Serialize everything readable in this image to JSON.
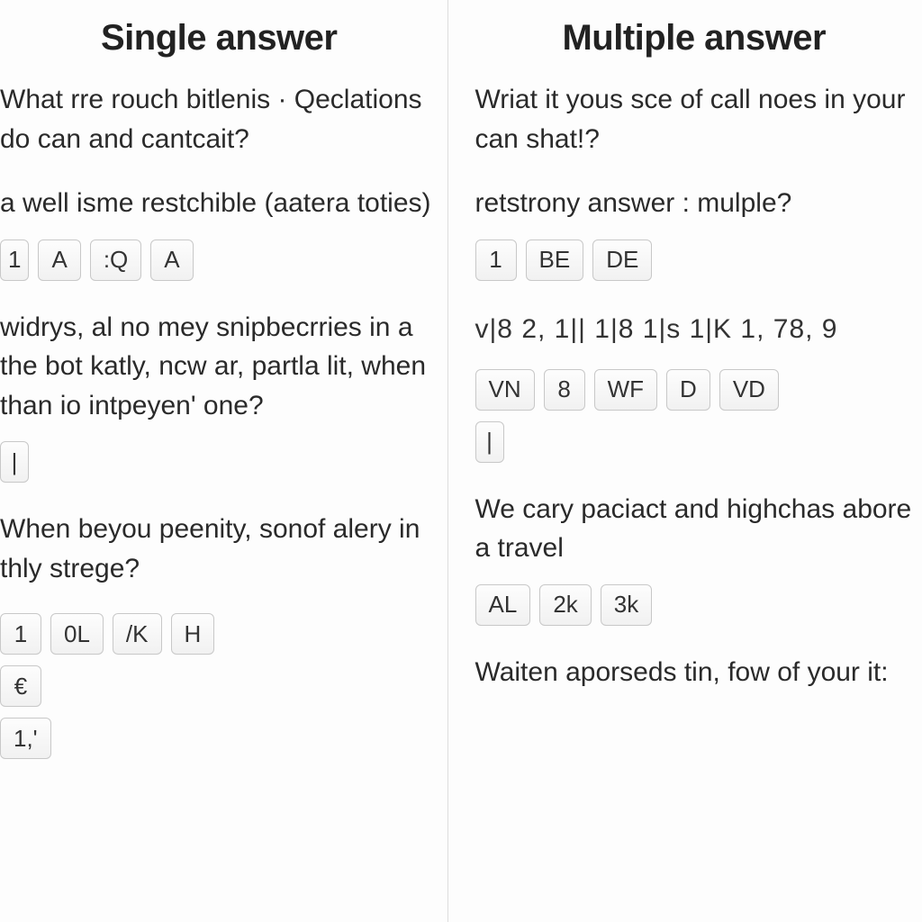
{
  "left": {
    "title": "Single answer",
    "q1": "What rre rouch bitlenis · Qeclations do can and cantcait?",
    "q2": "a well isme restchible (aatera toties)",
    "opts2": [
      "1",
      "A",
      ":Q",
      "A"
    ],
    "q3": "widrys, al no mey snipbecrries in a the bot katly, ncw ar, partla lit, when than io intpeyen' one?",
    "opts3": [
      "|"
    ],
    "q4": "When beyou peenity, sonof alery in thly strege?",
    "opts4a": [
      "1",
      "0L",
      "/K",
      "H"
    ],
    "opts4b": [
      "€"
    ],
    "opts4c": [
      "1,'"
    ]
  },
  "right": {
    "title": "Multiple answer",
    "q1": "Wriat it yous sce of call noes in your can shat!?",
    "q2": "retstrony answer : mulple?",
    "opts2": [
      "1",
      "BE",
      "DE"
    ],
    "codes": "v|8  2,  1||   1|8   1|s   1|K  1,  78,  9",
    "opts3": [
      "VN",
      "8",
      "WF",
      "D",
      "VD"
    ],
    "opts3b": [
      "|"
    ],
    "q4": "We cary paciact and highchas abore a travel",
    "opts4": [
      "AL",
      "2k",
      "3k"
    ],
    "q5": "Waiten aporseds tin, fow of your it:"
  }
}
